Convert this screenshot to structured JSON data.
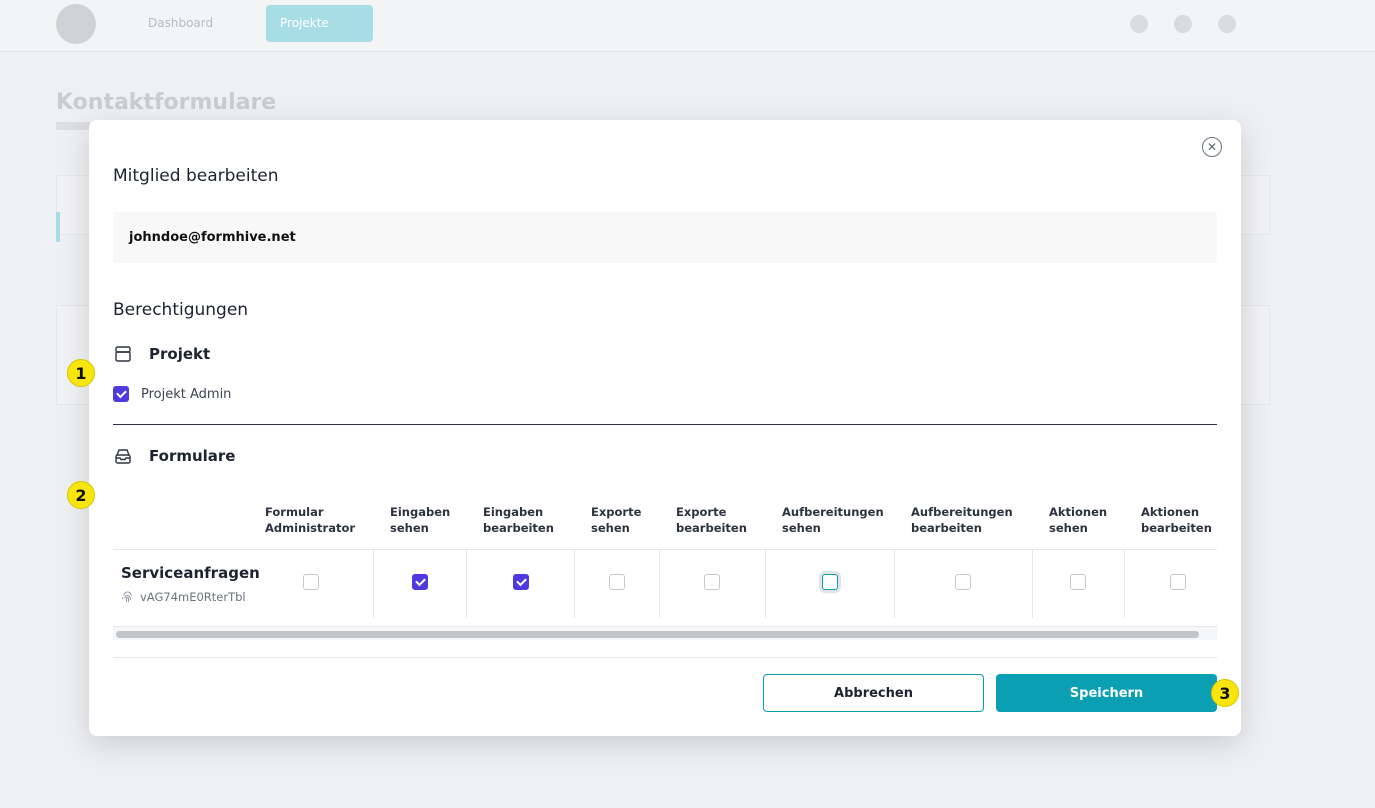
{
  "background": {
    "nav_dashboard": "Dashboard",
    "nav_projects": "Projekte",
    "page_title": "Kontaktformulare"
  },
  "modal": {
    "title": "Mitglied bearbeiten",
    "email": "johndoe@formhive.net",
    "close_icon": "close-circle-icon",
    "permissions_title": "Berechtigungen",
    "project_group": {
      "icon": "archive-icon",
      "title": "Projekt",
      "admin_label": "Projekt Admin",
      "admin_checked": true
    },
    "forms_group": {
      "icon": "inbox-tray-icon",
      "title": "Formulare"
    },
    "table": {
      "columns": [
        {
          "line1": "Formular",
          "line2": "Administrator"
        },
        {
          "line1": "Eingaben",
          "line2": "sehen"
        },
        {
          "line1": "Eingaben",
          "line2": "bearbeiten"
        },
        {
          "line1": "Exporte",
          "line2": "sehen"
        },
        {
          "line1": "Exporte",
          "line2": "bearbeiten"
        },
        {
          "line1": "Aufbereitungen",
          "line2": "sehen"
        },
        {
          "line1": "Aufbereitungen",
          "line2": "bearbeiten"
        },
        {
          "line1": "Aktionen",
          "line2": "sehen"
        },
        {
          "line1": "Aktionen",
          "line2": "bearbeiten"
        }
      ],
      "rows": [
        {
          "name": "Serviceanfragen",
          "id": "vAG74mE0RterTbl",
          "id_icon": "fingerprint-icon",
          "checks": [
            false,
            true,
            true,
            false,
            false,
            false,
            false,
            false,
            false
          ]
        }
      ]
    },
    "cancel_label": "Abbrechen",
    "save_label": "Speichern"
  },
  "badges": [
    "1",
    "2",
    "3"
  ],
  "colors": {
    "accent": "#0b9fb3",
    "checkbox": "#4f3ae0",
    "badge": "#f7e50d"
  }
}
